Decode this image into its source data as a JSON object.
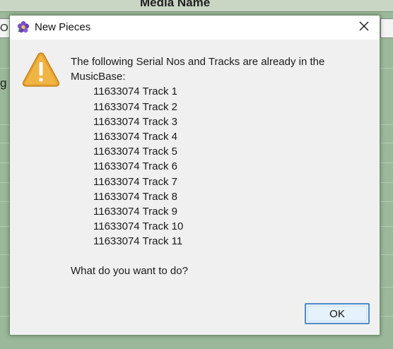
{
  "background": {
    "header_title": "Media Name",
    "field_text": "O",
    "label_text": "g"
  },
  "dialog": {
    "title": "New Pieces",
    "app_icon": "flower-app-icon",
    "close_icon": "close-icon",
    "warning_icon": "warning-icon",
    "intro_line_1": "The following Serial Nos and Tracks are already in the",
    "intro_line_2": "MusicBase:",
    "tracks": [
      "11633074 Track 1",
      "11633074 Track 2",
      "11633074 Track 3",
      "11633074 Track 4",
      "11633074 Track 5",
      "11633074 Track 6",
      "11633074 Track 7",
      "11633074 Track 8",
      "11633074 Track 9",
      "11633074 Track 10",
      "11633074 Track 11"
    ],
    "question": "What do you want to do?",
    "ok_label": "OK"
  },
  "colors": {
    "accent": "#4f8bc7",
    "warning": "#e7a02e",
    "background_app": "#9bb99a"
  }
}
